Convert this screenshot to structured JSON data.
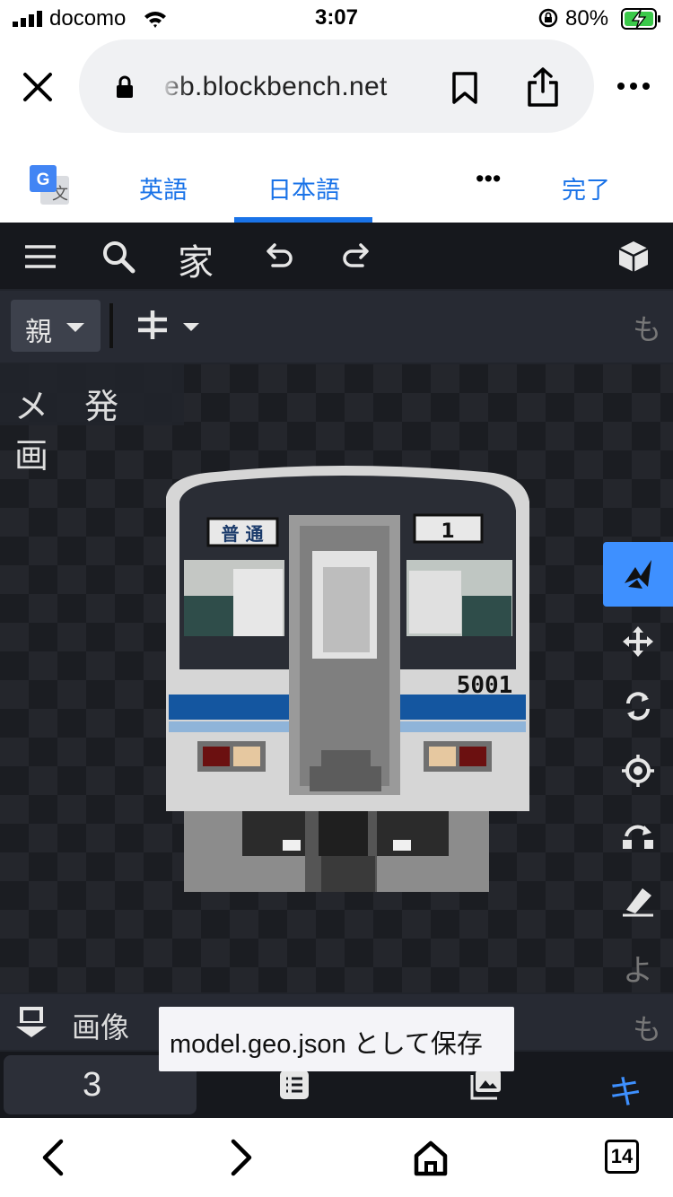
{
  "status_bar": {
    "carrier": "docomo",
    "time": "3:07",
    "battery": "80%"
  },
  "browser": {
    "url": "eb.blockbench.net",
    "translate": {
      "lang_english": "英語",
      "lang_japanese": "日本語",
      "more": "•••",
      "done": "完了",
      "selected": "日本語"
    },
    "tabs_count": "14"
  },
  "app": {
    "toolbar": {
      "home_label": "家"
    },
    "toolbar2": {
      "parent_label": "親",
      "more_label": "も"
    },
    "viewport": {
      "menu_label": "メ 発 画",
      "model_number": "5001",
      "destination_sign": "普 通",
      "route_sign": "1"
    },
    "tools": {
      "extra_label": "よ"
    },
    "bottom_panel": {
      "label": "画像",
      "more_label": "も"
    },
    "tooltip": "model.geo.json として保存",
    "tabbar": {
      "first_tab": "3",
      "last_tab": "キ"
    },
    "accent_color": "#3e90ff"
  }
}
